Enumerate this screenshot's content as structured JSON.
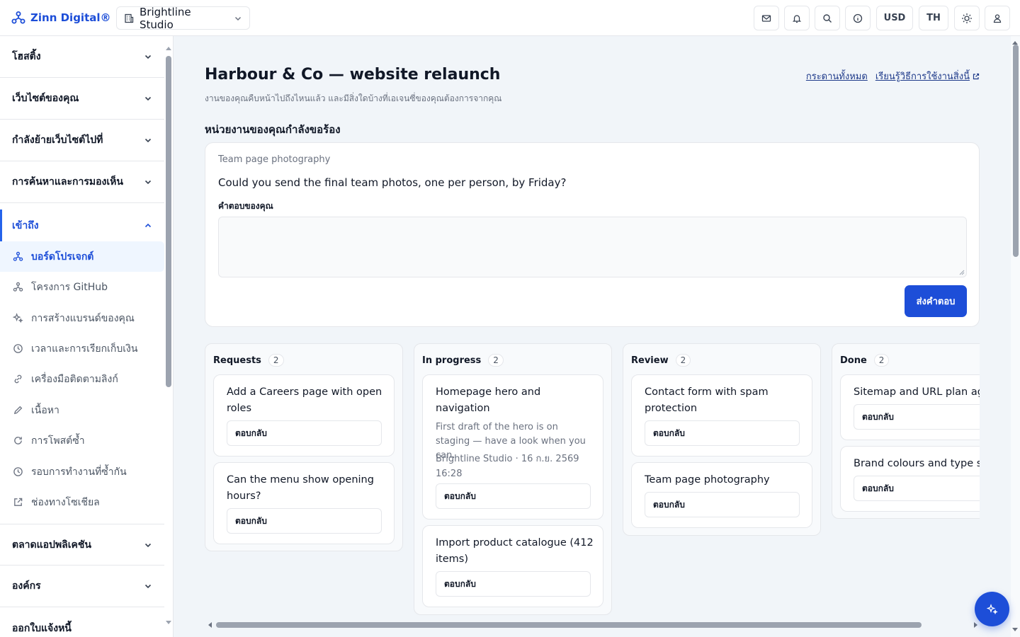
{
  "brand": {
    "name": "Zinn Digital®"
  },
  "workspace": {
    "name": "Brightline Studio"
  },
  "topbar": {
    "currency": "USD",
    "language": "TH"
  },
  "sidebar": {
    "sections": [
      {
        "label": "โฮสติ้ง"
      },
      {
        "label": "เว็บไซต์ของคุณ"
      },
      {
        "label": "กำลังย้ายเว็บไซต์ไปที่"
      },
      {
        "label": "การค้นหาและการมองเห็น"
      },
      {
        "label": "เข้าถึง"
      },
      {
        "label": "ตลาดแอปพลิเคชัน"
      },
      {
        "label": "องค์กร"
      },
      {
        "label": "ออกใบแจ้งหนี้"
      }
    ],
    "items": [
      {
        "label": "บอร์ดโปรเจกต์",
        "icon": "project-board-icon"
      },
      {
        "label": "โครงการ GitHub",
        "icon": "github-project-icon"
      },
      {
        "label": "การสร้างแบรนด์ของคุณ",
        "icon": "sparkle-icon"
      },
      {
        "label": "เวลาและการเรียกเก็บเงิน",
        "icon": "clock-icon"
      },
      {
        "label": "เครื่องมือติดตามลิงก์",
        "icon": "link-icon"
      },
      {
        "label": "เนื้อหา",
        "icon": "pencil-icon"
      },
      {
        "label": "การโพสต์ซ้ำ",
        "icon": "refresh-icon"
      },
      {
        "label": "รอบการทำงานที่ซ้ำกัน",
        "icon": "cycle-clock-icon"
      },
      {
        "label": "ช่องทางโซเชียล",
        "icon": "external-link-icon"
      }
    ]
  },
  "page": {
    "title": "Harbour & Co — website relaunch",
    "subtitle": "งานของคุณคืบหน้าไปถึงไหนแล้ว และมีสิ่งใดบ้างที่เอเจนซี่ของคุณต้องการจากคุณ",
    "link_all_boards": "กระดานทั้งหมด",
    "link_learn": "เรียนรู้วิธีการใช้งานสิ่งนี้"
  },
  "request": {
    "section_title": "หน่วยงานของคุณกำลังขอร้อง",
    "label": "Team page photography",
    "question": "Could you send the final team photos, one per person, by Friday?",
    "answer_label": "คำตอบของคุณ",
    "answer_value": "",
    "send_label": "ส่งคำตอบ"
  },
  "board": {
    "reply_label": "ตอบกลับ",
    "columns": [
      {
        "title": "Requests",
        "count": "2",
        "cards": [
          {
            "title": "Add a Careers page with open roles"
          },
          {
            "title": "Can the menu show opening hours?"
          }
        ]
      },
      {
        "title": "In progress",
        "count": "2",
        "cards": [
          {
            "title": "Homepage hero and navigation",
            "note": "First draft of the hero is on staging — have a look when you can.",
            "meta": "Brightline Studio · 16 ก.ย. 2569 16:28"
          },
          {
            "title": "Import product catalogue (412 items)"
          }
        ]
      },
      {
        "title": "Review",
        "count": "2",
        "cards": [
          {
            "title": "Contact form with spam protection"
          },
          {
            "title": "Team page photography"
          }
        ]
      },
      {
        "title": "Done",
        "count": "2",
        "cards": [
          {
            "title": "Sitemap and URL plan agreed"
          },
          {
            "title": "Brand colours and type set"
          }
        ]
      }
    ]
  },
  "colors": {
    "accent": "#1d4ed8",
    "background": "#f1f5f9",
    "border": "#e5e7eb"
  }
}
